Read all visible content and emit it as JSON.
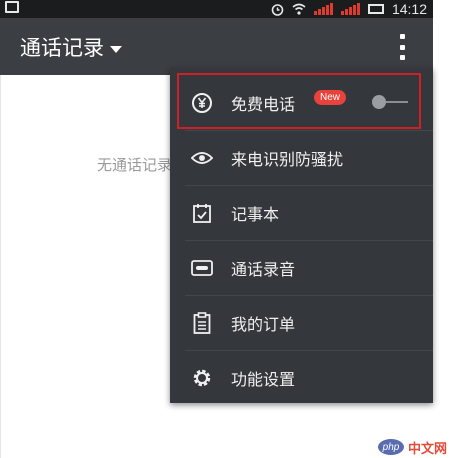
{
  "status_bar": {
    "time": "14:12",
    "icons": [
      "gallery-icon",
      "alarm-icon",
      "wifi-icon",
      "signal-icon",
      "battery-icon"
    ]
  },
  "app_bar": {
    "title": "通话记录",
    "dropdown_icon": "caret-down-icon",
    "overflow_icon": "more-vertical-icon"
  },
  "content": {
    "empty_text": "无通话记录"
  },
  "menu": {
    "items": [
      {
        "label": "免费电话",
        "icon": "yen-circle-icon",
        "badge": "New",
        "toggle_on": false
      },
      {
        "label": "来电识别防骚扰",
        "icon": "eye-icon"
      },
      {
        "label": "记事本",
        "icon": "calendar-check-icon"
      },
      {
        "label": "通话录音",
        "icon": "tape-icon"
      },
      {
        "label": "我的订单",
        "icon": "clipboard-icon"
      },
      {
        "label": "功能设置",
        "icon": "gear-icon"
      }
    ]
  },
  "watermark": {
    "logo": "php",
    "text": "中文网"
  },
  "colors": {
    "app_bar": "#3b3e43",
    "menu": "#34373c",
    "highlight": "#cf2027",
    "badge": "#e8423b"
  }
}
